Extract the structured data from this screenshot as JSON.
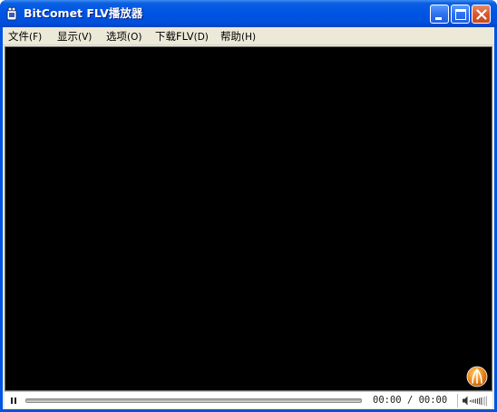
{
  "window": {
    "title": "BitComet FLV播放器"
  },
  "menu": {
    "items": [
      {
        "label": "文件",
        "accel": "(F)"
      },
      {
        "label": "显示",
        "accel": "(V)"
      },
      {
        "label": "选项",
        "accel": "(O)"
      },
      {
        "label": "下载FLV",
        "accel": "(D)"
      },
      {
        "label": "帮助",
        "accel": "(H)"
      }
    ]
  },
  "player": {
    "time_current": "00:00",
    "time_separator": "/",
    "time_total": "00:00",
    "progress": 0,
    "volume_level": 0.7
  },
  "icons": {
    "app": "bitcomet-app-icon",
    "logo": "bitcomet-logo-icon",
    "pause": "pause-icon",
    "volume": "volume-icon"
  },
  "colors": {
    "titlebar": "#0055e5",
    "close_button": "#d9582e",
    "video_background": "#000000",
    "logo": "#f08a1c"
  }
}
